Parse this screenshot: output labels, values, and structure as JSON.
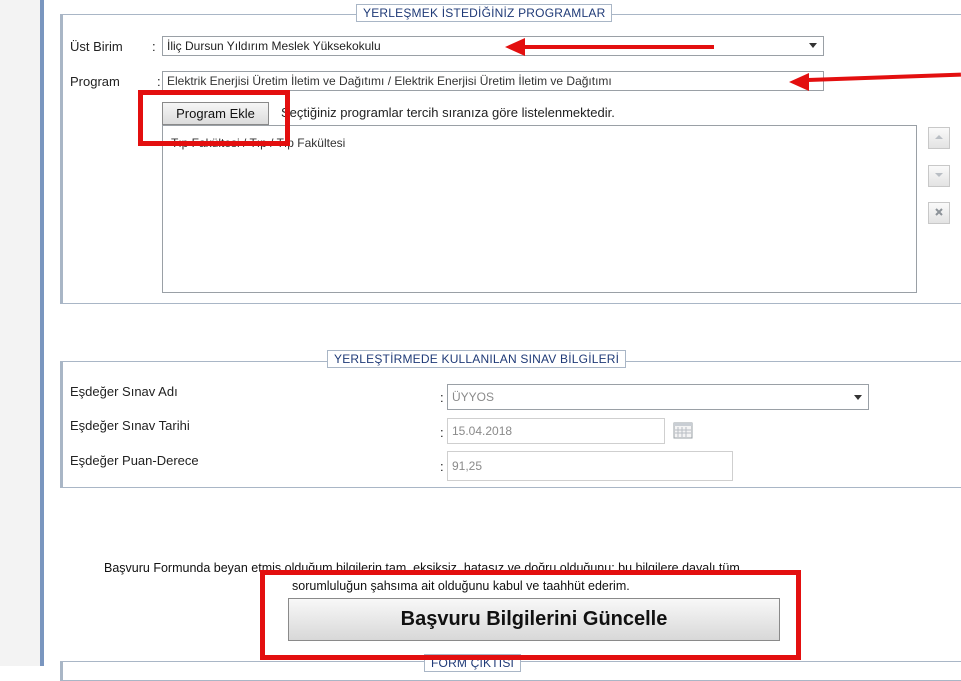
{
  "programs_section": {
    "legend": "YERLEŞMEK İSTEDİĞİNİZ PROGRAMLAR",
    "unit_label": "Üst Birim",
    "unit_value": "İliç Dursun Yıldırım Meslek Yüksekokulu",
    "program_label": "Program",
    "program_value": "Elektrik Enerjisi Üretim İletim ve Dağıtımı / Elektrik Enerjisi Üretim İletim ve Dağıtımı",
    "add_button": "Program Ekle",
    "order_note": "Seçtiğiniz programlar tercih sıranıza göre listelenmektedir.",
    "selected_programs": [
      "Tıp Fakültesi / Tıp / Tıp Fakültesi"
    ]
  },
  "exam_section": {
    "legend": "YERLEŞTİRMEDE KULLANILAN SINAV BİLGİLERİ",
    "exam_name_label": "Eşdeğer Sınav Adı",
    "exam_name_value": "ÜYYOS",
    "exam_date_label": "Eşdeğer Sınav Tarihi",
    "exam_date_value": "15.04.2018",
    "score_label": "Eşdeğer Puan-Derece",
    "score_value": "91,25"
  },
  "declaration": {
    "line1": "Başvuru Formunda beyan etmiş olduğum bilgilerin tam, eksiksiz, hatasız ve doğru olduğunu; bu bilgilere dayalı tüm",
    "line2": "sorumluluğun şahsıma ait olduğunu kabul ve taahhüt ederim.",
    "update_button": "Başvuru Bilgilerini Güncelle"
  },
  "form_output_section": {
    "legend": "FORM ÇIKTISI"
  },
  "colors": {
    "annotation_red": "#e30f0f",
    "legend_text": "#1f3a77"
  }
}
